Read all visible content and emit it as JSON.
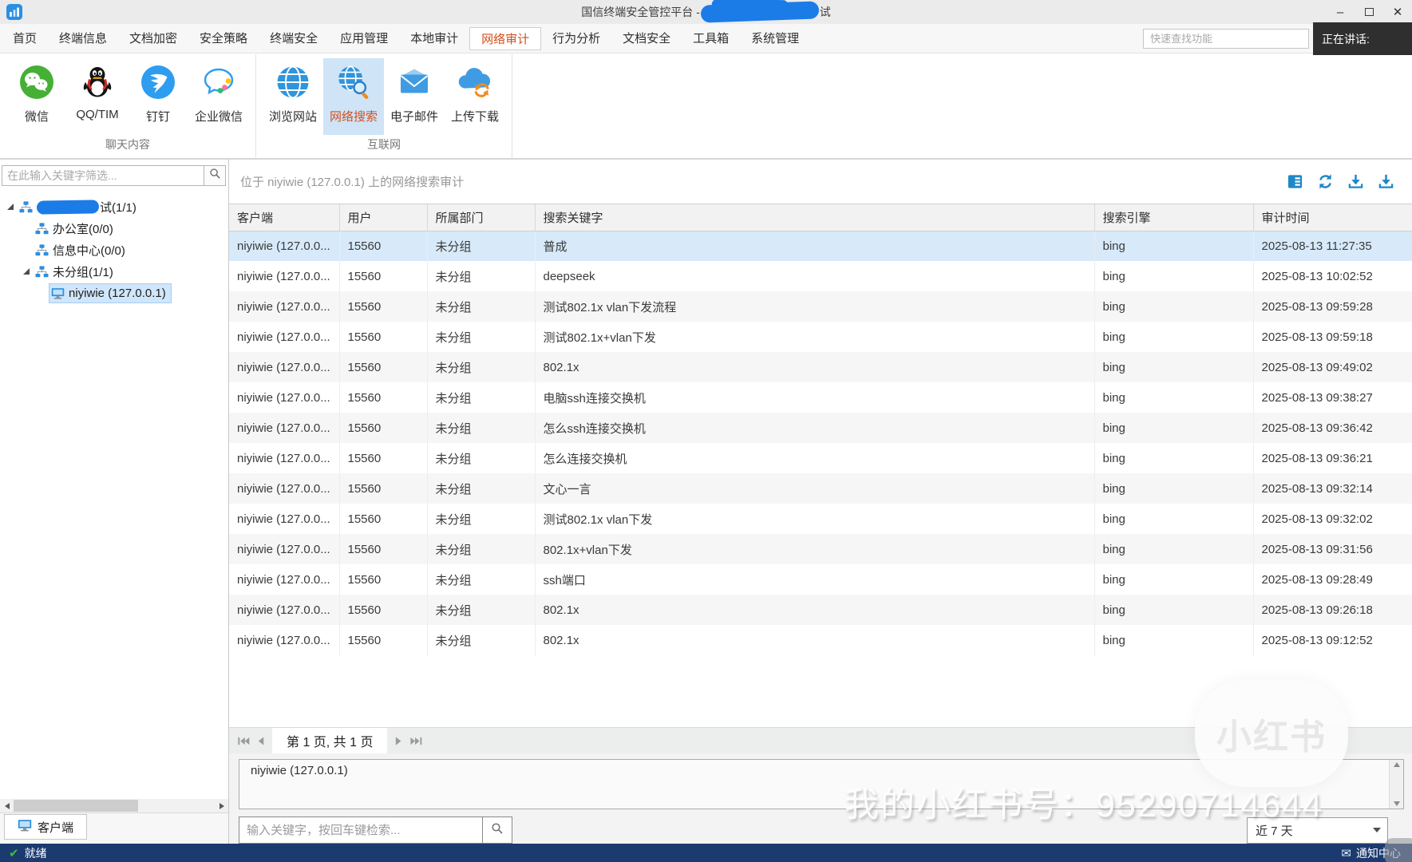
{
  "colors": {
    "accent": "#1e88c7",
    "highlight_text": "#d2501e",
    "selection_bg": "#d8eafa",
    "tool_selected_bg": "#cfe4f7",
    "statusbar_bg": "#1b3a70",
    "scribble": "#1b7ce8",
    "ready_check": "#35c435"
  },
  "window": {
    "title_prefix": "国信终端安全管控平台 - ",
    "title_redacted_suffix": "试",
    "minimize_glyph": "–",
    "close_glyph": "✕"
  },
  "meeting_overlay": {
    "label": "正在讲话:"
  },
  "menu": {
    "tabs": [
      "首页",
      "终端信息",
      "文档加密",
      "安全策略",
      "终端安全",
      "应用管理",
      "本地审计",
      "网络审计",
      "行为分析",
      "文档安全",
      "工具箱",
      "系统管理"
    ],
    "active_tab": "网络审计",
    "quick_search_placeholder": "快速查找功能"
  },
  "ribbon": {
    "active_tool": "网络搜索",
    "groups": [
      {
        "label": "聊天内容",
        "tools": [
          {
            "label": "微信",
            "icon": "wechat-icon"
          },
          {
            "label": "QQ/TIM",
            "icon": "qq-icon"
          },
          {
            "label": "钉钉",
            "icon": "dingtalk-icon"
          },
          {
            "label": "企业微信",
            "icon": "wecom-icon"
          }
        ]
      },
      {
        "label": "互联网",
        "tools": [
          {
            "label": "浏览网站",
            "icon": "browse-globe-icon"
          },
          {
            "label": "网络搜索",
            "icon": "web-search-icon"
          },
          {
            "label": "电子邮件",
            "icon": "mail-icon"
          },
          {
            "label": "上传下载",
            "icon": "upload-download-icon"
          }
        ]
      }
    ]
  },
  "sidebar": {
    "filter_placeholder": "在此输入关键字筛选...",
    "tree": [
      {
        "indent": 0,
        "expanded": true,
        "icon": "org-icon",
        "redacted": true,
        "label": "试(1/1)",
        "selected": false
      },
      {
        "indent": 1,
        "expanded": false,
        "icon": "org-icon",
        "redacted": false,
        "label": "办公室(0/0)",
        "selected": false
      },
      {
        "indent": 1,
        "expanded": false,
        "icon": "org-icon",
        "redacted": false,
        "label": "信息中心(0/0)",
        "selected": false
      },
      {
        "indent": 1,
        "expanded": true,
        "icon": "org-icon",
        "redacted": false,
        "label": "未分组(1/1)",
        "selected": false
      },
      {
        "indent": 2,
        "expanded": false,
        "icon": "pc-icon",
        "redacted": false,
        "label": "niyiwie (127.0.0.1)",
        "selected": true
      }
    ],
    "tab_label": "客户端"
  },
  "main": {
    "header": "位于 niyiwie (127.0.0.1) 上的网络搜索审计",
    "actions": [
      "detail-view-icon",
      "refresh-icon",
      "export-icon",
      "download-icon"
    ],
    "table": {
      "selected_row": 0,
      "columns": [
        "客户端",
        "用户",
        "所属部门",
        "搜索关键字",
        "搜索引擎",
        "审计时间"
      ],
      "rows": [
        [
          "niyiwie (127.0.0...",
          "15560",
          "未分组",
          "普成",
          "bing",
          "2025-08-13 11:27:35"
        ],
        [
          "niyiwie (127.0.0...",
          "15560",
          "未分组",
          "deepseek",
          "bing",
          "2025-08-13 10:02:52"
        ],
        [
          "niyiwie (127.0.0...",
          "15560",
          "未分组",
          "测试802.1x vlan下发流程",
          "bing",
          "2025-08-13 09:59:28"
        ],
        [
          "niyiwie (127.0.0...",
          "15560",
          "未分组",
          "测试802.1x+vlan下发",
          "bing",
          "2025-08-13 09:59:18"
        ],
        [
          "niyiwie (127.0.0...",
          "15560",
          "未分组",
          "802.1x",
          "bing",
          "2025-08-13 09:49:02"
        ],
        [
          "niyiwie (127.0.0...",
          "15560",
          "未分组",
          "电脑ssh连接交换机",
          "bing",
          "2025-08-13 09:38:27"
        ],
        [
          "niyiwie (127.0.0...",
          "15560",
          "未分组",
          "怎么ssh连接交换机",
          "bing",
          "2025-08-13 09:36:42"
        ],
        [
          "niyiwie (127.0.0...",
          "15560",
          "未分组",
          "怎么连接交换机",
          "bing",
          "2025-08-13 09:36:21"
        ],
        [
          "niyiwie (127.0.0...",
          "15560",
          "未分组",
          "文心一言",
          "bing",
          "2025-08-13 09:32:14"
        ],
        [
          "niyiwie (127.0.0...",
          "15560",
          "未分组",
          "测试802.1x vlan下发",
          "bing",
          "2025-08-13 09:32:02"
        ],
        [
          "niyiwie (127.0.0...",
          "15560",
          "未分组",
          "802.1x+vlan下发",
          "bing",
          "2025-08-13 09:31:56"
        ],
        [
          "niyiwie (127.0.0...",
          "15560",
          "未分组",
          "ssh端口",
          "bing",
          "2025-08-13 09:28:49"
        ],
        [
          "niyiwie (127.0.0...",
          "15560",
          "未分组",
          "802.1x",
          "bing",
          "2025-08-13 09:26:18"
        ],
        [
          "niyiwie (127.0.0...",
          "15560",
          "未分组",
          "802.1x",
          "bing",
          "2025-08-13 09:12:52"
        ]
      ]
    },
    "pagination": {
      "page_text": "第 1 页, 共 1 页"
    },
    "detail_panel": {
      "items": [
        "niyiwie (127.0.0.1)"
      ]
    },
    "keyword_placeholder": "输入关键字，按回车键检索...",
    "date_range": "近 7 天"
  },
  "statusbar": {
    "ready_icon": "✔",
    "ready": "就绪",
    "mail_icon": "✉",
    "notification": "通知中心"
  },
  "watermark": {
    "logo_text": "小红书",
    "line_text": "我的小红书号：95290714644"
  }
}
